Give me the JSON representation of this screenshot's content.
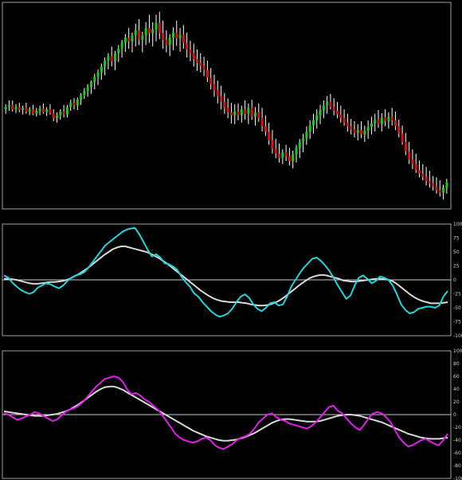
{
  "chart_data": [
    {
      "type": "candlestick",
      "panel": "price",
      "colors": {
        "up": "#11d011",
        "down": "#e01010",
        "neutral": "#ffffff"
      },
      "ohlc": [
        [
          118,
          112,
          125,
          121
        ],
        [
          121,
          116,
          130,
          124
        ],
        [
          124,
          115,
          130,
          118
        ],
        [
          118,
          113,
          125,
          121
        ],
        [
          121,
          114,
          127,
          117
        ],
        [
          117,
          111,
          123,
          120
        ],
        [
          120,
          112,
          127,
          115
        ],
        [
          115,
          110,
          121,
          118
        ],
        [
          118,
          110,
          124,
          112
        ],
        [
          112,
          108,
          120,
          116
        ],
        [
          116,
          110,
          123,
          119
        ],
        [
          119,
          112,
          126,
          114
        ],
        [
          114,
          109,
          121,
          118
        ],
        [
          118,
          111,
          125,
          113
        ],
        [
          113,
          102,
          118,
          106
        ],
        [
          106,
          100,
          114,
          110
        ],
        [
          110,
          104,
          118,
          115
        ],
        [
          115,
          107,
          124,
          111
        ],
        [
          111,
          107,
          124,
          121
        ],
        [
          121,
          116,
          131,
          127
        ],
        [
          127,
          118,
          133,
          123
        ],
        [
          123,
          117,
          134,
          131
        ],
        [
          131,
          124,
          140,
          137
        ],
        [
          137,
          132,
          147,
          143
        ],
        [
          143,
          135,
          152,
          148
        ],
        [
          148,
          139,
          157,
          155
        ],
        [
          155,
          145,
          166,
          162
        ],
        [
          162,
          151,
          172,
          168
        ],
        [
          168,
          158,
          180,
          176
        ],
        [
          176,
          164,
          188,
          184
        ],
        [
          184,
          172,
          194,
          190
        ],
        [
          190,
          176,
          203,
          183
        ],
        [
          183,
          171,
          197,
          194
        ],
        [
          194,
          182,
          205,
          200
        ],
        [
          200,
          188,
          212,
          208
        ],
        [
          208,
          196,
          220,
          215
        ],
        [
          215,
          200,
          228,
          210
        ],
        [
          210,
          195,
          222,
          218
        ],
        [
          218,
          203,
          234,
          225
        ],
        [
          225,
          205,
          240,
          212
        ],
        [
          212,
          195,
          223,
          218
        ],
        [
          218,
          205,
          236,
          228
        ],
        [
          228,
          208,
          246,
          221
        ],
        [
          221,
          203,
          236,
          226
        ],
        [
          226,
          210,
          246,
          235
        ],
        [
          235,
          213,
          250,
          221
        ],
        [
          221,
          200,
          238,
          212
        ],
        [
          212,
          195,
          225,
          205
        ],
        [
          205,
          190,
          220,
          215
        ],
        [
          215,
          198,
          229,
          222
        ],
        [
          222,
          204,
          238,
          214
        ],
        [
          214,
          196,
          228,
          219
        ],
        [
          219,
          200,
          232,
          208
        ],
        [
          208,
          188,
          222,
          199
        ],
        [
          199,
          183,
          211,
          194
        ],
        [
          194,
          176,
          207,
          186
        ],
        [
          186,
          170,
          199,
          181
        ],
        [
          181,
          168,
          194,
          177
        ],
        [
          177,
          163,
          189,
          171
        ],
        [
          171,
          155,
          184,
          161
        ],
        [
          161,
          145,
          174,
          152
        ],
        [
          152,
          135,
          165,
          144
        ],
        [
          144,
          126,
          157,
          136
        ],
        [
          136,
          118,
          150,
          128
        ],
        [
          128,
          112,
          140,
          120
        ],
        [
          120,
          106,
          133,
          114
        ],
        [
          114,
          99,
          127,
          110
        ],
        [
          110,
          98,
          125,
          115
        ],
        [
          115,
          103,
          126,
          110
        ],
        [
          110,
          100,
          123,
          118
        ],
        [
          118,
          104,
          130,
          112
        ],
        [
          112,
          98,
          126,
          120
        ],
        [
          120,
          104,
          131,
          108
        ],
        [
          108,
          96,
          121,
          114
        ],
        [
          114,
          101,
          126,
          106
        ],
        [
          106,
          88,
          120,
          95
        ],
        [
          95,
          82,
          110,
          88
        ],
        [
          88,
          70,
          100,
          76
        ],
        [
          76,
          58,
          90,
          65
        ],
        [
          65,
          52,
          78,
          58
        ],
        [
          58,
          46,
          72,
          52
        ],
        [
          52,
          44,
          64,
          60
        ],
        [
          60,
          48,
          70,
          55
        ],
        [
          55,
          42,
          66,
          48
        ],
        [
          48,
          38,
          62,
          57
        ],
        [
          57,
          46,
          70,
          66
        ],
        [
          66,
          52,
          78,
          74
        ],
        [
          74,
          60,
          85,
          79
        ],
        [
          79,
          70,
          95,
          88
        ],
        [
          88,
          78,
          103,
          96
        ],
        [
          96,
          85,
          112,
          103
        ],
        [
          103,
          92,
          118,
          110
        ],
        [
          110,
          98,
          124,
          117
        ],
        [
          117,
          106,
          130,
          123
        ],
        [
          123,
          112,
          136,
          128
        ],
        [
          128,
          118,
          139,
          121
        ],
        [
          121,
          110,
          133,
          116
        ],
        [
          116,
          106,
          128,
          111
        ],
        [
          111,
          100,
          123,
          106
        ],
        [
          106,
          96,
          118,
          100
        ],
        [
          100,
          88,
          112,
          95
        ],
        [
          95,
          84,
          105,
          91
        ],
        [
          91,
          80,
          102,
          86
        ],
        [
          86,
          76,
          98,
          90
        ],
        [
          90,
          79,
          102,
          84
        ],
        [
          84,
          74,
          96,
          89
        ],
        [
          89,
          78,
          103,
          94
        ],
        [
          94,
          84,
          108,
          99
        ],
        [
          99,
          88,
          112,
          104
        ],
        [
          104,
          93,
          117,
          98
        ],
        [
          98,
          88,
          113,
          107
        ],
        [
          107,
          95,
          118,
          102
        ],
        [
          102,
          92,
          114,
          108
        ],
        [
          108,
          96,
          120,
          103
        ],
        [
          103,
          90,
          115,
          95
        ],
        [
          95,
          80,
          104,
          85
        ],
        [
          85,
          70,
          96,
          74
        ],
        [
          74,
          56,
          86,
          61
        ],
        [
          61,
          44,
          74,
          50
        ],
        [
          50,
          37,
          64,
          44
        ],
        [
          44,
          32,
          58,
          36
        ],
        [
          36,
          26,
          49,
          31
        ],
        [
          31,
          22,
          44,
          27
        ],
        [
          27,
          15,
          40,
          21
        ],
        [
          21,
          12,
          35,
          18
        ],
        [
          18,
          8,
          28,
          14
        ],
        [
          14,
          4,
          26,
          9
        ],
        [
          9,
          0,
          22,
          5
        ],
        [
          5,
          -4,
          16,
          12
        ],
        [
          12,
          4,
          24,
          19
        ]
      ]
    },
    {
      "type": "line",
      "panel": "oscillator-1",
      "ylim": [
        -100,
        100
      ],
      "tick_labels": [
        "100",
        "75",
        "50",
        "25",
        "0",
        "-25",
        "-50",
        "-75",
        "-100"
      ],
      "zero_line": 0,
      "series": [
        {
          "color": "#1fd6e0",
          "values": [
            8,
            4,
            -5,
            -12,
            -18,
            -22,
            -25,
            -22,
            -14,
            -10,
            -6,
            -8,
            -12,
            -15,
            -10,
            -2,
            4,
            8,
            10,
            14,
            22,
            32,
            42,
            52,
            62,
            68,
            74,
            80,
            86,
            90,
            92,
            93,
            82,
            68,
            54,
            42,
            46,
            40,
            30,
            28,
            24,
            18,
            6,
            -4,
            -12,
            -24,
            -30,
            -40,
            -48,
            -56,
            -62,
            -66,
            -64,
            -60,
            -52,
            -40,
            -30,
            -26,
            -32,
            -44,
            -52,
            -56,
            -50,
            -42,
            -40,
            -46,
            -44,
            -30,
            -12,
            0,
            12,
            22,
            30,
            38,
            40,
            34,
            26,
            16,
            4,
            -10,
            -22,
            -34,
            -28,
            -10,
            4,
            8,
            2,
            -6,
            -2,
            6,
            4,
            0,
            -10,
            -26,
            -44,
            -54,
            -60,
            -58,
            -52,
            -50,
            -48,
            -48,
            -50,
            -46,
            -30,
            -20
          ]
        },
        {
          "color": "#d8d8d8",
          "values": [
            2,
            2,
            1,
            0,
            -2,
            -4,
            -6,
            -7,
            -7,
            -6,
            -5,
            -4,
            -4,
            -3,
            -2,
            0,
            3,
            7,
            11,
            16,
            21,
            27,
            33,
            39,
            45,
            50,
            55,
            58,
            60,
            60,
            58,
            56,
            54,
            52,
            50,
            47,
            43,
            39,
            34,
            29,
            23,
            17,
            11,
            5,
            -1,
            -7,
            -13,
            -19,
            -24,
            -29,
            -33,
            -36,
            -38,
            -39,
            -40,
            -40,
            -40,
            -41,
            -42,
            -44,
            -45,
            -46,
            -46,
            -45,
            -43,
            -40,
            -36,
            -31,
            -25,
            -19,
            -13,
            -7,
            -2,
            3,
            6,
            8,
            9,
            8,
            6,
            4,
            2,
            -1,
            -2,
            -3,
            -3,
            -2,
            -1,
            0,
            1,
            2,
            2,
            1,
            0,
            -3,
            -8,
            -14,
            -20,
            -26,
            -31,
            -35,
            -38,
            -40,
            -42,
            -42,
            -42,
            -41,
            -40
          ]
        }
      ]
    },
    {
      "type": "line",
      "panel": "oscillator-2",
      "ylim": [
        -100,
        100
      ],
      "tick_labels": [
        "100",
        "80",
        "60",
        "40",
        "20",
        "0",
        "-20",
        "-40",
        "-60",
        "-80",
        "-100"
      ],
      "zero_line": 0,
      "series": [
        {
          "color": "#e020e8",
          "values": [
            2,
            0,
            -4,
            -8,
            -6,
            -3,
            0,
            4,
            2,
            -2,
            -6,
            -10,
            -8,
            -2,
            4,
            8,
            10,
            14,
            20,
            28,
            36,
            44,
            50,
            56,
            58,
            60,
            58,
            52,
            40,
            32,
            34,
            30,
            24,
            20,
            14,
            8,
            0,
            -10,
            -20,
            -30,
            -36,
            -40,
            -42,
            -44,
            -42,
            -38,
            -36,
            -40,
            -48,
            -52,
            -54,
            -50,
            -46,
            -40,
            -36,
            -34,
            -30,
            -22,
            -12,
            -6,
            0,
            2,
            -4,
            -8,
            -10,
            -14,
            -16,
            -18,
            -20,
            -22,
            -18,
            -12,
            -4,
            4,
            12,
            14,
            6,
            2,
            -6,
            -14,
            -20,
            -24,
            -16,
            -6,
            2,
            4,
            2,
            -4,
            -12,
            -24,
            -36,
            -44,
            -50,
            -48,
            -44,
            -40,
            -38,
            -42,
            -46,
            -48,
            -40,
            -30
          ]
        },
        {
          "color": "#d8d8d8",
          "values": [
            5,
            4,
            3,
            2,
            1,
            0,
            -1,
            -2,
            -2,
            -2,
            -1,
            0,
            1,
            3,
            5,
            8,
            12,
            16,
            21,
            26,
            31,
            36,
            40,
            43,
            44,
            44,
            42,
            39,
            35,
            31,
            27,
            23,
            19,
            15,
            11,
            7,
            3,
            -1,
            -5,
            -9,
            -13,
            -17,
            -21,
            -25,
            -28,
            -31,
            -34,
            -36,
            -38,
            -40,
            -41,
            -41,
            -40,
            -39,
            -37,
            -35,
            -32,
            -29,
            -25,
            -21,
            -17,
            -13,
            -10,
            -8,
            -7,
            -7,
            -8,
            -9,
            -10,
            -11,
            -11,
            -11,
            -10,
            -8,
            -6,
            -4,
            -2,
            -1,
            0,
            0,
            -1,
            -2,
            -4,
            -6,
            -8,
            -10,
            -12,
            -15,
            -18,
            -21,
            -24,
            -27,
            -30,
            -32,
            -34,
            -36,
            -37,
            -38,
            -38,
            -38,
            -37,
            -36
          ]
        }
      ]
    }
  ]
}
